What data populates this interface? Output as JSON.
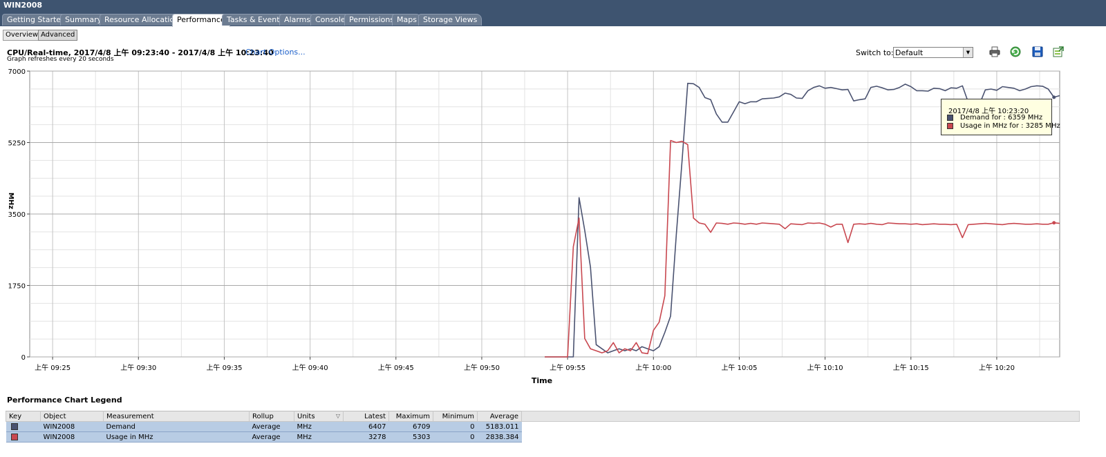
{
  "window": {
    "title": "WIN2008"
  },
  "tabs": [
    {
      "label": "Getting Started"
    },
    {
      "label": "Summary"
    },
    {
      "label": "Resource Allocation"
    },
    {
      "label": "Performance",
      "active": true
    },
    {
      "label": "Tasks & Events"
    },
    {
      "label": "Alarms"
    },
    {
      "label": "Console"
    },
    {
      "label": "Permissions"
    },
    {
      "label": "Maps"
    },
    {
      "label": "Storage Views"
    }
  ],
  "subtabs": [
    {
      "label": "Overview"
    },
    {
      "label": "Advanced",
      "active": true
    }
  ],
  "header": {
    "title": "CPU/Real-time, 2017/4/8 上午 09:23:40 - 2017/4/8 上午 10:23:40",
    "chart_options": "Chart Options...",
    "refresh_note": "Graph refreshes every 20 seconds",
    "switch_to_label": "Switch to:",
    "switch_to_value": "Default"
  },
  "toolbar": {
    "icons": [
      "print-icon",
      "refresh-icon",
      "save-icon",
      "export-icon"
    ]
  },
  "tooltip": {
    "time": "2017/4/8 上午 10:23:20",
    "demand": "Demand for : 6359 MHz",
    "usage": "Usage in MHz for : 3285 MHz"
  },
  "colors": {
    "demand": "#4a5270",
    "usage": "#c8474f",
    "titlebar": "#3e5470"
  },
  "chart_data": {
    "type": "line",
    "xlabel": "Time",
    "ylabel": "MHz",
    "ylim": [
      0,
      7000
    ],
    "yticks": [
      0,
      1750,
      3500,
      5250,
      7000
    ],
    "xlim": [
      "09:23:40",
      "10:23:40"
    ],
    "xticks": [
      "上午 09:25",
      "上午 09:30",
      "上午 09:35",
      "上午 09:40",
      "上午 09:45",
      "上午 09:50",
      "上午 09:55",
      "上午 10:00",
      "上午 10:05",
      "上午 10:10",
      "上午 10:15",
      "上午 10:20"
    ],
    "grid": true,
    "series": [
      {
        "name": "Demand",
        "color": "#4a5270",
        "points": [
          [
            "09:53:40",
            0
          ],
          [
            "09:54:00",
            0
          ],
          [
            "09:54:20",
            0
          ],
          [
            "09:54:40",
            0
          ],
          [
            "09:55:00",
            0
          ],
          [
            "09:55:20",
            0
          ],
          [
            "09:55:40",
            3900
          ],
          [
            "09:56:00",
            3100
          ],
          [
            "09:56:20",
            2200
          ],
          [
            "09:56:40",
            300
          ],
          [
            "09:57:00",
            200
          ],
          [
            "09:57:20",
            100
          ],
          [
            "09:57:40",
            150
          ],
          [
            "09:58:00",
            200
          ],
          [
            "09:58:20",
            150
          ],
          [
            "09:58:40",
            200
          ],
          [
            "09:59:00",
            150
          ],
          [
            "09:59:20",
            250
          ],
          [
            "09:59:40",
            200
          ],
          [
            "10:00:00",
            150
          ],
          [
            "10:00:20",
            250
          ],
          [
            "10:00:40",
            600
          ],
          [
            "10:01:00",
            1000
          ],
          [
            "10:01:20",
            3000
          ],
          [
            "10:01:40",
            4800
          ],
          [
            "10:02:00",
            6700
          ],
          [
            "10:02:20",
            6690
          ],
          [
            "10:02:40",
            6600
          ],
          [
            "10:03:00",
            6350
          ],
          [
            "10:03:20",
            6300
          ],
          [
            "10:03:40",
            5950
          ],
          [
            "10:04:00",
            5750
          ],
          [
            "10:04:20",
            5750
          ],
          [
            "10:04:40",
            6000
          ],
          [
            "10:05:00",
            6250
          ],
          [
            "10:05:20",
            6200
          ],
          [
            "10:05:40",
            6250
          ],
          [
            "10:06:00",
            6250
          ],
          [
            "10:06:20",
            6320
          ],
          [
            "10:06:40",
            6330
          ],
          [
            "10:07:00",
            6340
          ],
          [
            "10:07:20",
            6370
          ],
          [
            "10:07:40",
            6460
          ],
          [
            "10:08:00",
            6430
          ],
          [
            "10:08:20",
            6340
          ],
          [
            "10:08:40",
            6330
          ],
          [
            "10:09:00",
            6520
          ],
          [
            "10:09:20",
            6600
          ],
          [
            "10:09:40",
            6640
          ],
          [
            "10:10:00",
            6580
          ],
          [
            "10:10:20",
            6600
          ],
          [
            "10:10:40",
            6570
          ],
          [
            "10:11:00",
            6540
          ],
          [
            "10:11:20",
            6550
          ],
          [
            "10:11:40",
            6270
          ],
          [
            "10:12:00",
            6300
          ],
          [
            "10:12:20",
            6320
          ],
          [
            "10:12:40",
            6600
          ],
          [
            "10:13:00",
            6630
          ],
          [
            "10:13:20",
            6590
          ],
          [
            "10:13:40",
            6540
          ],
          [
            "10:14:00",
            6550
          ],
          [
            "10:14:20",
            6600
          ],
          [
            "10:14:40",
            6680
          ],
          [
            "10:15:00",
            6620
          ],
          [
            "10:15:20",
            6520
          ],
          [
            "10:15:40",
            6520
          ],
          [
            "10:16:00",
            6510
          ],
          [
            "10:16:20",
            6580
          ],
          [
            "10:16:40",
            6570
          ],
          [
            "10:17:00",
            6520
          ],
          [
            "10:17:20",
            6590
          ],
          [
            "10:17:40",
            6580
          ],
          [
            "10:18:00",
            6640
          ],
          [
            "10:18:20",
            6240
          ],
          [
            "10:18:40",
            6170
          ],
          [
            "10:19:00",
            6190
          ],
          [
            "10:19:20",
            6540
          ],
          [
            "10:19:40",
            6560
          ],
          [
            "10:20:00",
            6530
          ],
          [
            "10:20:20",
            6620
          ],
          [
            "10:20:40",
            6600
          ],
          [
            "10:21:00",
            6580
          ],
          [
            "10:21:20",
            6520
          ],
          [
            "10:21:40",
            6560
          ],
          [
            "10:22:00",
            6620
          ],
          [
            "10:22:20",
            6640
          ],
          [
            "10:22:40",
            6630
          ],
          [
            "10:23:00",
            6560
          ],
          [
            "10:23:20",
            6359
          ],
          [
            "10:23:40",
            6400
          ]
        ]
      },
      {
        "name": "Usage in MHz",
        "color": "#c8474f",
        "points": [
          [
            "09:53:40",
            0
          ],
          [
            "09:54:00",
            0
          ],
          [
            "09:54:20",
            0
          ],
          [
            "09:54:40",
            0
          ],
          [
            "09:55:00",
            0
          ],
          [
            "09:55:20",
            2700
          ],
          [
            "09:55:40",
            3400
          ],
          [
            "09:56:00",
            450
          ],
          [
            "09:56:20",
            200
          ],
          [
            "09:56:40",
            150
          ],
          [
            "09:57:00",
            100
          ],
          [
            "09:57:20",
            150
          ],
          [
            "09:57:40",
            350
          ],
          [
            "09:58:00",
            100
          ],
          [
            "09:58:20",
            200
          ],
          [
            "09:58:40",
            150
          ],
          [
            "09:59:00",
            350
          ],
          [
            "09:59:20",
            100
          ],
          [
            "09:59:40",
            80
          ],
          [
            "10:00:00",
            650
          ],
          [
            "10:00:20",
            850
          ],
          [
            "10:00:40",
            1500
          ],
          [
            "10:01:00",
            5300
          ],
          [
            "10:01:20",
            5250
          ],
          [
            "10:01:40",
            5280
          ],
          [
            "10:02:00",
            5200
          ],
          [
            "10:02:20",
            3400
          ],
          [
            "10:02:40",
            3280
          ],
          [
            "10:03:00",
            3250
          ],
          [
            "10:03:20",
            3050
          ],
          [
            "10:03:40",
            3280
          ],
          [
            "10:04:00",
            3270
          ],
          [
            "10:04:20",
            3250
          ],
          [
            "10:04:40",
            3280
          ],
          [
            "10:05:00",
            3270
          ],
          [
            "10:05:20",
            3250
          ],
          [
            "10:05:40",
            3270
          ],
          [
            "10:06:00",
            3250
          ],
          [
            "10:06:20",
            3280
          ],
          [
            "10:06:40",
            3270
          ],
          [
            "10:07:00",
            3260
          ],
          [
            "10:07:20",
            3250
          ],
          [
            "10:07:40",
            3140
          ],
          [
            "10:08:00",
            3260
          ],
          [
            "10:08:20",
            3250
          ],
          [
            "10:08:40",
            3240
          ],
          [
            "10:09:00",
            3280
          ],
          [
            "10:09:20",
            3270
          ],
          [
            "10:09:40",
            3280
          ],
          [
            "10:10:00",
            3250
          ],
          [
            "10:10:20",
            3180
          ],
          [
            "10:10:40",
            3250
          ],
          [
            "10:11:00",
            3250
          ],
          [
            "10:11:20",
            2800
          ],
          [
            "10:11:40",
            3250
          ],
          [
            "10:12:00",
            3260
          ],
          [
            "10:12:20",
            3250
          ],
          [
            "10:12:40",
            3270
          ],
          [
            "10:13:00",
            3250
          ],
          [
            "10:13:20",
            3240
          ],
          [
            "10:13:40",
            3280
          ],
          [
            "10:14:00",
            3270
          ],
          [
            "10:14:20",
            3260
          ],
          [
            "10:14:40",
            3260
          ],
          [
            "10:15:00",
            3250
          ],
          [
            "10:15:20",
            3260
          ],
          [
            "10:15:40",
            3240
          ],
          [
            "10:16:00",
            3250
          ],
          [
            "10:16:20",
            3260
          ],
          [
            "10:16:40",
            3250
          ],
          [
            "10:17:00",
            3250
          ],
          [
            "10:17:20",
            3240
          ],
          [
            "10:17:40",
            3250
          ],
          [
            "10:18:00",
            2920
          ],
          [
            "10:18:20",
            3240
          ],
          [
            "10:18:40",
            3250
          ],
          [
            "10:19:00",
            3260
          ],
          [
            "10:19:20",
            3270
          ],
          [
            "10:19:40",
            3260
          ],
          [
            "10:20:00",
            3250
          ],
          [
            "10:20:20",
            3240
          ],
          [
            "10:20:40",
            3260
          ],
          [
            "10:21:00",
            3270
          ],
          [
            "10:21:20",
            3260
          ],
          [
            "10:21:40",
            3250
          ],
          [
            "10:22:00",
            3250
          ],
          [
            "10:22:20",
            3260
          ],
          [
            "10:22:40",
            3250
          ],
          [
            "10:23:00",
            3250
          ],
          [
            "10:23:20",
            3285
          ],
          [
            "10:23:40",
            3270
          ]
        ]
      }
    ]
  },
  "legend": {
    "title": "Performance Chart Legend",
    "columns": [
      "Key",
      "Object",
      "Measurement",
      "Rollup",
      "Units",
      "Latest",
      "Maximum",
      "Minimum",
      "Average"
    ],
    "rows": [
      {
        "object": "WIN2008",
        "measurement": "Demand",
        "rollup": "Average",
        "units": "MHz",
        "latest": "6407",
        "maximum": "6709",
        "minimum": "0",
        "average": "5183.011",
        "color": "#4a5270"
      },
      {
        "object": "WIN2008",
        "measurement": "Usage in MHz",
        "rollup": "Average",
        "units": "MHz",
        "latest": "3278",
        "maximum": "5303",
        "minimum": "0",
        "average": "2838.384",
        "color": "#c8474f"
      }
    ]
  }
}
